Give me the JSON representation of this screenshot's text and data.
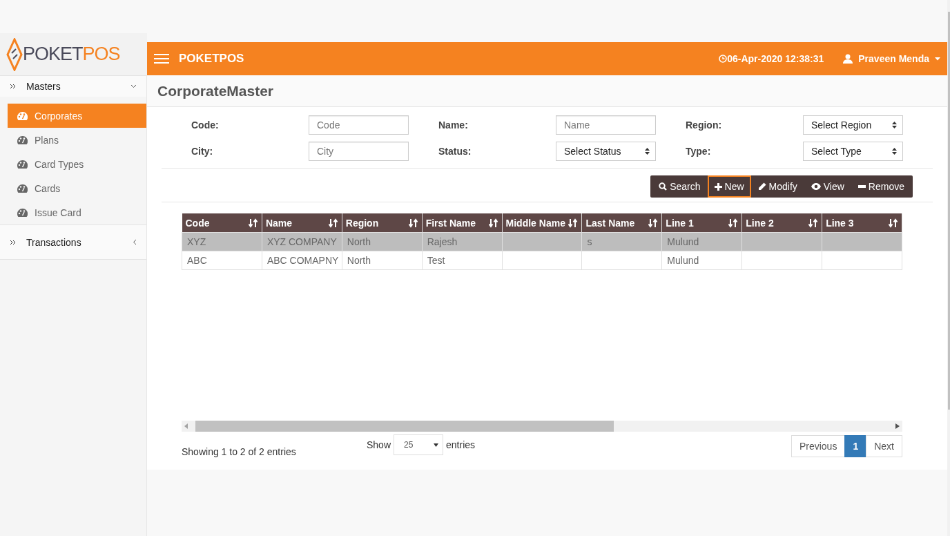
{
  "logo": {
    "dark": "POKET",
    "accent": "POS"
  },
  "header": {
    "brand": "POKETPOS",
    "datetime": "06-Apr-2020 12:38:31",
    "user": "Praveen Menda"
  },
  "sidebar": {
    "groups": [
      {
        "label": "Masters",
        "expanded": true,
        "items": [
          {
            "label": "Corporates",
            "selected": true
          },
          {
            "label": "Plans",
            "selected": false
          },
          {
            "label": "Card Types",
            "selected": false
          },
          {
            "label": "Cards",
            "selected": false
          },
          {
            "label": "Issue Card",
            "selected": false
          }
        ]
      },
      {
        "label": "Transactions",
        "expanded": false
      }
    ]
  },
  "page_title": "CorporateMaster",
  "filters": [
    {
      "label": "Code:",
      "kind": "text",
      "placeholder": "Code"
    },
    {
      "label": "Name:",
      "kind": "text",
      "placeholder": "Name"
    },
    {
      "label": "Region:",
      "kind": "select",
      "value": "Select Region"
    },
    {
      "label": "City:",
      "kind": "text",
      "placeholder": "City"
    },
    {
      "label": "Status:",
      "kind": "select",
      "value": "Select Status"
    },
    {
      "label": "Type:",
      "kind": "select",
      "value": "Select Type"
    }
  ],
  "actions": [
    {
      "label": "Search",
      "kind": "search",
      "selected": false
    },
    {
      "label": "New",
      "kind": "plus",
      "selected": true
    },
    {
      "label": "Modify",
      "kind": "pencil",
      "selected": false
    },
    {
      "label": "View",
      "kind": "eye",
      "selected": false
    },
    {
      "label": "Remove",
      "kind": "minus",
      "selected": false
    }
  ],
  "table": {
    "columns": [
      "Code",
      "Name",
      "Region",
      "First Name",
      "Middle Name",
      "Last Name",
      "Line 1",
      "Line 2",
      "Line 3"
    ],
    "rows": [
      {
        "selected": true,
        "cells": [
          "XYZ",
          "XYZ COMPANY",
          "North",
          "Rajesh",
          null,
          "s",
          "Mulund",
          null,
          null
        ]
      },
      {
        "selected": false,
        "cells": [
          "ABC",
          "ABC COMAPNY",
          "North",
          "Test",
          null,
          null,
          "Mulund",
          null,
          null
        ]
      }
    ]
  },
  "footer": {
    "info": "Showing 1 to 2 of 2 entries",
    "length": {
      "before": "Show",
      "value": "25",
      "after": "entries"
    },
    "pages": [
      {
        "label": "Previous",
        "selected": false
      },
      {
        "label": "1",
        "selected": true
      },
      {
        "label": "Next",
        "selected": false
      }
    ]
  }
}
